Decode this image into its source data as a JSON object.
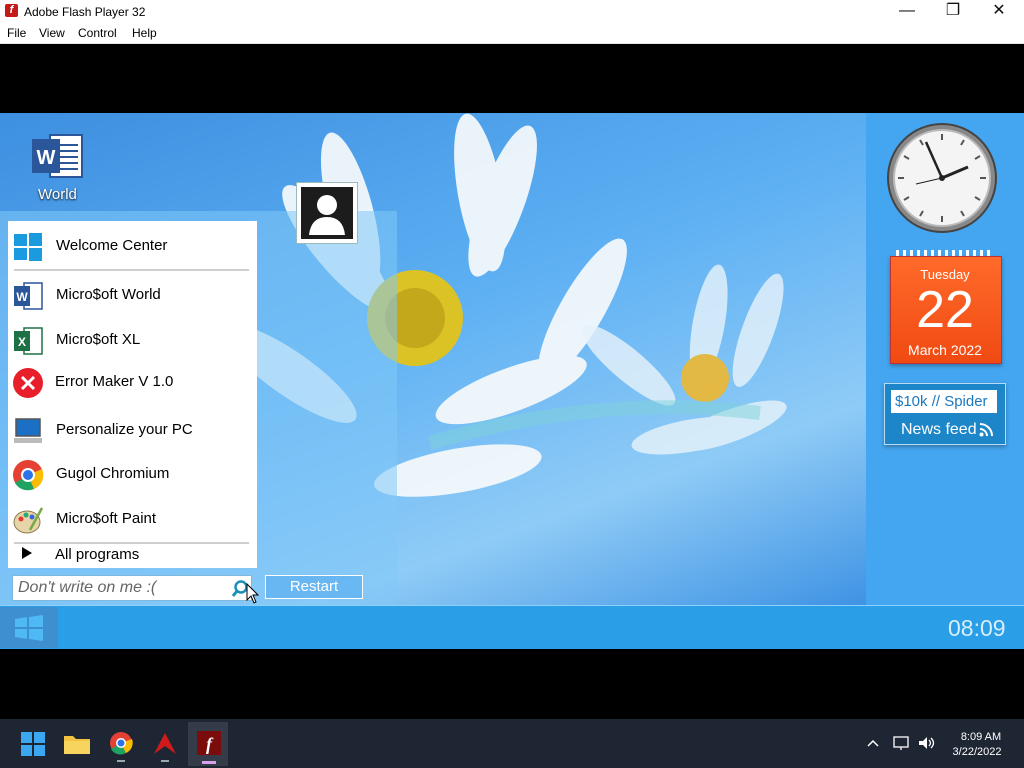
{
  "window": {
    "title": "Adobe Flash Player 32"
  },
  "menu": [
    "File",
    "View",
    "Control",
    "Help"
  ],
  "desktop": {
    "icon_label": "World",
    "clock": "08:09"
  },
  "start_menu": {
    "items": [
      {
        "label": "Welcome Center"
      },
      {
        "label": "Micro$oft World"
      },
      {
        "label": "Micro$oft XL"
      },
      {
        "label": "Error Maker V 1.0"
      },
      {
        "label": "Personalize your PC"
      },
      {
        "label": "Gugol Chromium"
      },
      {
        "label": "Micro$oft Paint"
      }
    ],
    "all_programs": "All programs",
    "search_placeholder": "Don't write on me :(",
    "restart": "Restart"
  },
  "calendar": {
    "day": "Tuesday",
    "date": "22",
    "month": "March 2022"
  },
  "news": {
    "ticker": "$10k // Spider",
    "label": "News feed"
  },
  "taskbar": {
    "time": "8:09 AM",
    "date": "3/22/2022"
  },
  "colors": {
    "flash_red": "#c51a1a",
    "win8_blue": "#2a9ee6",
    "calendar_orange": "#f04a12"
  }
}
